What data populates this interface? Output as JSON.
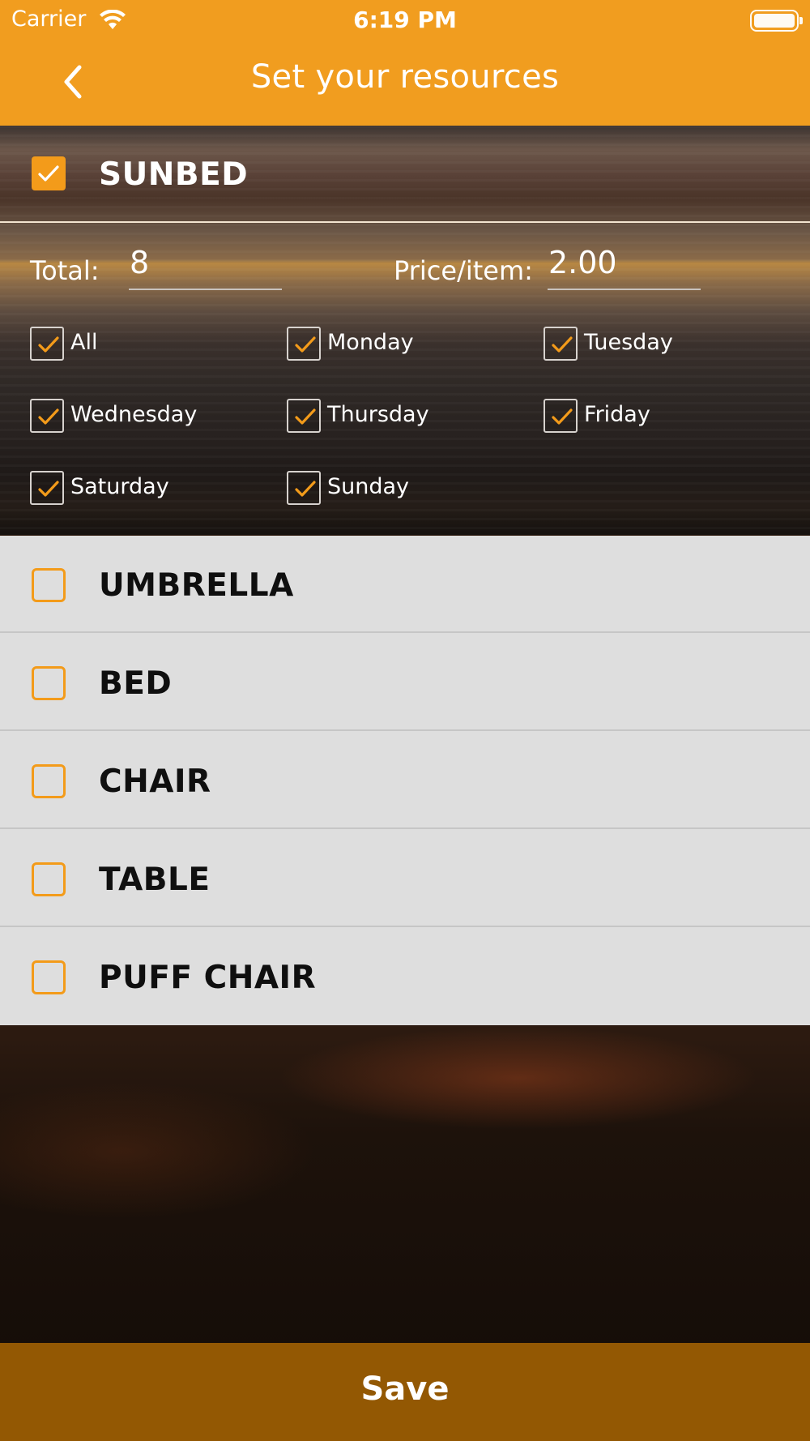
{
  "status_bar": {
    "carrier": "Carrier",
    "time": "6:19 PM"
  },
  "nav": {
    "title": "Set your resources",
    "back_icon": "chevron-left-icon"
  },
  "accent_color": "#f19d1f",
  "sunbed": {
    "name": "SUNBED",
    "checked": true,
    "total_label": "Total:",
    "total_value": "8",
    "price_label": "Price/item:",
    "price_value": "2.00",
    "days": [
      {
        "label": "All",
        "checked": true
      },
      {
        "label": "Monday",
        "checked": true
      },
      {
        "label": "Tuesday",
        "checked": true
      },
      {
        "label": "Wednesday",
        "checked": true
      },
      {
        "label": "Thursday",
        "checked": true
      },
      {
        "label": "Friday",
        "checked": true
      },
      {
        "label": "Saturday",
        "checked": true
      },
      {
        "label": "Sunday",
        "checked": true
      }
    ]
  },
  "resources": [
    {
      "name": "UMBRELLA",
      "checked": false
    },
    {
      "name": "BED",
      "checked": false
    },
    {
      "name": "CHAIR",
      "checked": false
    },
    {
      "name": "TABLE",
      "checked": false
    },
    {
      "name": "PUFF CHAIR",
      "checked": false
    }
  ],
  "save_label": "Save"
}
